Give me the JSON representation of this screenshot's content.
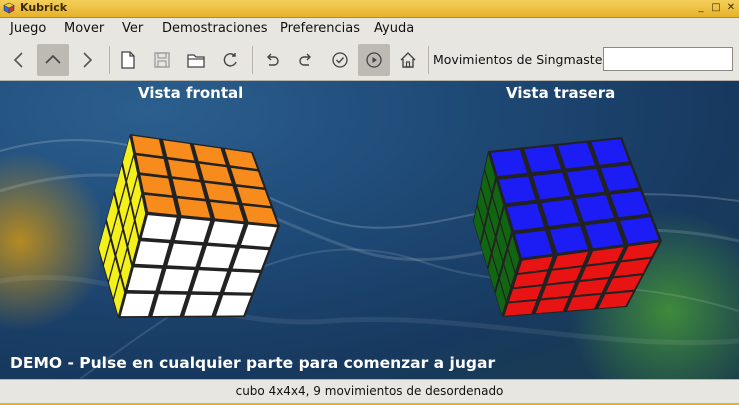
{
  "window": {
    "title": "Kubrick"
  },
  "menu": [
    "Juego",
    "Mover",
    "Ver",
    "Demostraciones",
    "Preferencias",
    "Ayuda"
  ],
  "toolbar": {
    "buttons": [
      "back",
      "up",
      "forward",
      "new",
      "save",
      "open",
      "refresh",
      "undo",
      "redo",
      "check",
      "play",
      "home"
    ],
    "singmaster_label": "Movimientos de Singmaster",
    "singmaster_value": ""
  },
  "views": {
    "front": "Vista frontal",
    "back": "Vista trasera"
  },
  "demo_text": "DEMO - Pulse en cualquier parte para comenzar a jugar",
  "status": "cubo 4x4x4, 9 movimientos de desordenado",
  "colors": {
    "orange": "#f78b1c",
    "yellow": "#f4f01c",
    "white": "#ffffff",
    "blue": "#1c1cf4",
    "red": "#e81414",
    "green": "#116611"
  }
}
